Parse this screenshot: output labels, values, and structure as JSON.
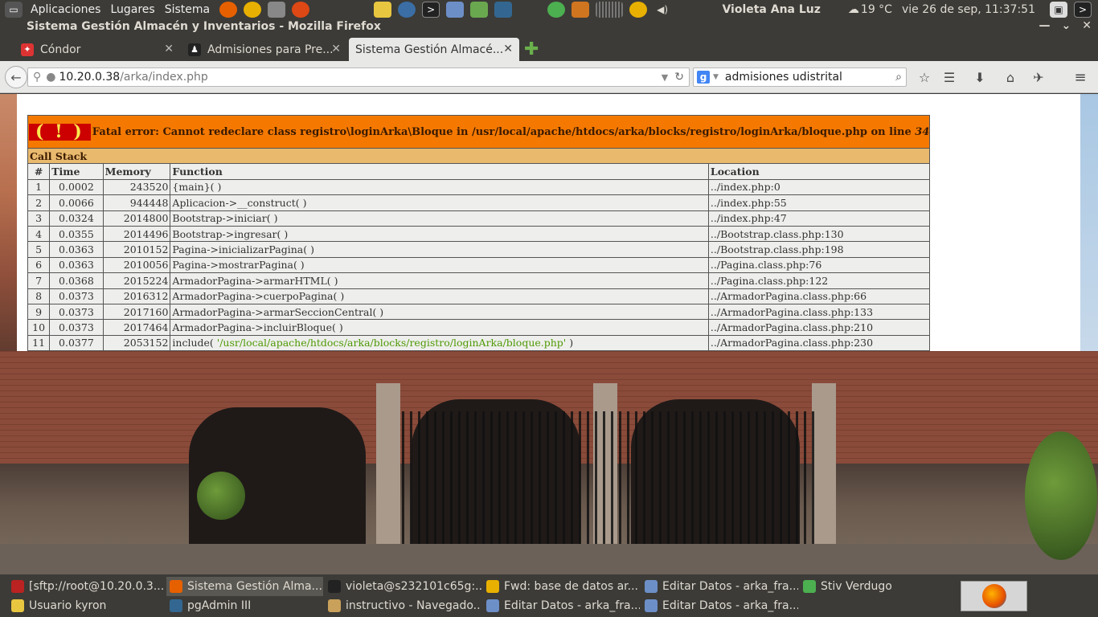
{
  "top_panel": {
    "menus": [
      "Aplicaciones",
      "Lugares",
      "Sistema"
    ],
    "user": "Violeta Ana Luz",
    "weather": "19 °C",
    "clock": "vie 26 de sep, 11:37:51"
  },
  "window": {
    "title": "Sistema Gestión Almacén y Inventarios - Mozilla Firefox"
  },
  "tabs": [
    {
      "label": "Cóndor",
      "icon": "condor-favicon"
    },
    {
      "label": "Admisiones para Pre...",
      "icon": "admisiones-favicon"
    },
    {
      "label": "Sistema Gestión Almacé...",
      "icon": "none",
      "active": true
    }
  ],
  "navbar": {
    "url_host": "10.20.0.38",
    "url_path": "/arka/index.php",
    "search_value": "admisiones udistrital"
  },
  "error": {
    "bang": "( ! )",
    "message": "Fatal error: Cannot redeclare class registro\\loginArka\\Bloque in /usr/local/apache/htdocs/arka/blocks/registro/loginArka/bloque.php on line ",
    "line": "34",
    "call_stack_title": "Call Stack",
    "headers": [
      "#",
      "Time",
      "Memory",
      "Function",
      "Location"
    ],
    "rows": [
      {
        "n": "1",
        "time": "0.0002",
        "memory": "243520",
        "function": "{main}( )",
        "location": "../index.php:0"
      },
      {
        "n": "2",
        "time": "0.0066",
        "memory": "944448",
        "function": "Aplicacion->__construct( )",
        "location": "../index.php:55"
      },
      {
        "n": "3",
        "time": "0.0324",
        "memory": "2014800",
        "function": "Bootstrap->iniciar( )",
        "location": "../index.php:47"
      },
      {
        "n": "4",
        "time": "0.0355",
        "memory": "2014496",
        "function": "Bootstrap->ingresar( )",
        "location": "../Bootstrap.class.php:130"
      },
      {
        "n": "5",
        "time": "0.0363",
        "memory": "2010152",
        "function": "Pagina->inicializarPagina( )",
        "location": "../Bootstrap.class.php:198"
      },
      {
        "n": "6",
        "time": "0.0363",
        "memory": "2010056",
        "function": "Pagina->mostrarPagina( )",
        "location": "../Pagina.class.php:76"
      },
      {
        "n": "7",
        "time": "0.0368",
        "memory": "2015224",
        "function": "ArmadorPagina->armarHTML( )",
        "location": "../Pagina.class.php:122"
      },
      {
        "n": "8",
        "time": "0.0373",
        "memory": "2016312",
        "function": "ArmadorPagina->cuerpoPagina( )",
        "location": "../ArmadorPagina.class.php:66"
      },
      {
        "n": "9",
        "time": "0.0373",
        "memory": "2017160",
        "function": "ArmadorPagina->armarSeccionCentral( )",
        "location": "../ArmadorPagina.class.php:133"
      },
      {
        "n": "10",
        "time": "0.0373",
        "memory": "2017464",
        "function": "ArmadorPagina->incluirBloque( )",
        "location": "../ArmadorPagina.class.php:210"
      },
      {
        "n": "11",
        "time": "0.0377",
        "memory": "2053152",
        "function_prefix": "include( ",
        "function_path": "'/usr/local/apache/htdocs/arka/blocks/registro/loginArka/bloque.php'",
        "function_suffix": " )",
        "location": "../ArmadorPagina.class.php:230"
      }
    ]
  },
  "taskbar": {
    "row1": [
      {
        "label": "[sftp://root@10.20.0.3...",
        "icon": "filezilla-icon"
      },
      {
        "label": "Sistema Gestión Alma...",
        "icon": "firefox-icon",
        "active": true
      },
      {
        "label": "violeta@s232101c65g:...",
        "icon": "terminal-icon"
      },
      {
        "label": "Fwd: base de datos ar...",
        "icon": "chrome-icon"
      },
      {
        "label": "Editar Datos - arka_fra...",
        "icon": "document-icon"
      },
      {
        "label": "Stiv Verdugo",
        "icon": "chat-icon"
      }
    ],
    "row2": [
      {
        "label": "Usuario kyron",
        "icon": "notes-icon"
      },
      {
        "label": "pgAdmin III",
        "icon": "pgadmin-icon"
      },
      {
        "label": "instructivo - Navegado...",
        "icon": "folder-icon"
      },
      {
        "label": "Editar Datos - arka_fra...",
        "icon": "document-icon"
      },
      {
        "label": "Editar Datos - arka_fra...",
        "icon": "document-icon"
      }
    ]
  },
  "colors": {
    "panel_bg": "#3c3b37",
    "error_orange": "#f57900",
    "error_red": "#cc0000",
    "callstack_tan": "#e9b96e",
    "include_path_green": "#4e9a06"
  }
}
